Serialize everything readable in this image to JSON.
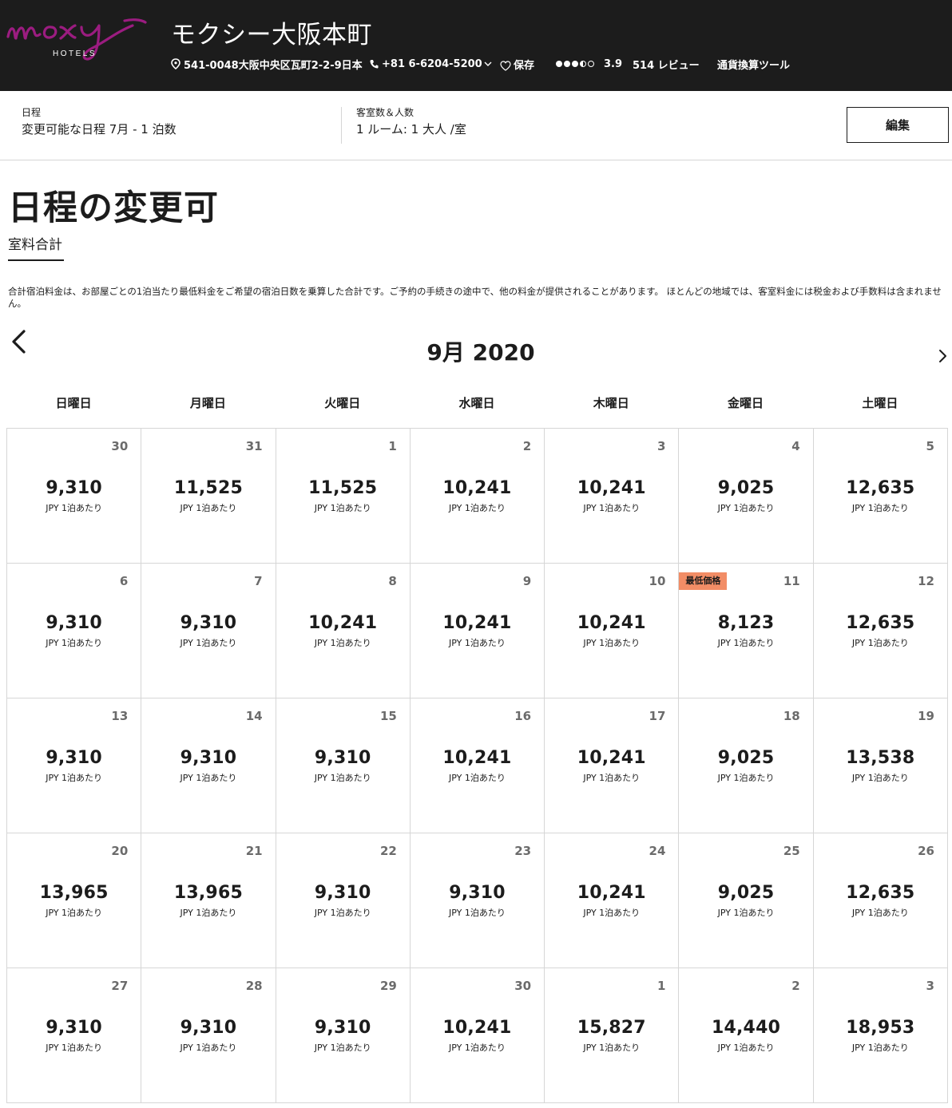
{
  "header": {
    "logo_text": "moxy",
    "logo_sub": "HOTELS",
    "hotel_name": "モクシー大阪本町",
    "address": "541-0048大阪中央区瓦町2-2-9日本",
    "phone": "+81 6-6204-5200",
    "save_label": "保存",
    "rating": "3.9",
    "reviews": "514 レビュー",
    "currency_tool": "通貨換算ツール",
    "brand_color": "#9b1c80"
  },
  "summary": {
    "dates_label": "日程",
    "dates_value": "変更可能な日程 7月 - 1 泊数",
    "guests_label": "客室数＆人数",
    "guests_value": "1 ルーム: 1 大人 /室",
    "edit_label": "編集"
  },
  "page": {
    "title": "日程の変更可",
    "tab_label": "室料合計",
    "note": "合計宿泊料金は、お部屋ごとの1泊当たり最低料金をご希望の宿泊日数を乗算した合計です。ご予約の手続きの途中で、他の料金が提供されることがあります。 ほとんどの地域では、客室料金には税金および手数料は含まれません。"
  },
  "calendar": {
    "month_title": "9月 2020",
    "unit_label": "JPY 1泊あたり",
    "lowest_badge": "最低価格",
    "badge_color": "#f28d66",
    "weekdays": [
      "日曜日",
      "月曜日",
      "火曜日",
      "水曜日",
      "木曜日",
      "金曜日",
      "土曜日"
    ],
    "weeks": [
      [
        {
          "day": "30",
          "price": "9,310"
        },
        {
          "day": "31",
          "price": "11,525"
        },
        {
          "day": "1",
          "price": "11,525"
        },
        {
          "day": "2",
          "price": "10,241"
        },
        {
          "day": "3",
          "price": "10,241"
        },
        {
          "day": "4",
          "price": "9,025"
        },
        {
          "day": "5",
          "price": "12,635"
        }
      ],
      [
        {
          "day": "6",
          "price": "9,310"
        },
        {
          "day": "7",
          "price": "9,310"
        },
        {
          "day": "8",
          "price": "10,241"
        },
        {
          "day": "9",
          "price": "10,241"
        },
        {
          "day": "10",
          "price": "10,241"
        },
        {
          "day": "11",
          "price": "8,123",
          "lowest": true
        },
        {
          "day": "12",
          "price": "12,635"
        }
      ],
      [
        {
          "day": "13",
          "price": "9,310"
        },
        {
          "day": "14",
          "price": "9,310"
        },
        {
          "day": "15",
          "price": "9,310"
        },
        {
          "day": "16",
          "price": "10,241"
        },
        {
          "day": "17",
          "price": "10,241"
        },
        {
          "day": "18",
          "price": "9,025"
        },
        {
          "day": "19",
          "price": "13,538"
        }
      ],
      [
        {
          "day": "20",
          "price": "13,965"
        },
        {
          "day": "21",
          "price": "13,965"
        },
        {
          "day": "22",
          "price": "9,310"
        },
        {
          "day": "23",
          "price": "9,310"
        },
        {
          "day": "24",
          "price": "10,241"
        },
        {
          "day": "25",
          "price": "9,025"
        },
        {
          "day": "26",
          "price": "12,635"
        }
      ],
      [
        {
          "day": "27",
          "price": "9,310"
        },
        {
          "day": "28",
          "price": "9,310"
        },
        {
          "day": "29",
          "price": "9,310"
        },
        {
          "day": "30",
          "price": "10,241"
        },
        {
          "day": "1",
          "price": "15,827"
        },
        {
          "day": "2",
          "price": "14,440"
        },
        {
          "day": "3",
          "price": "18,953"
        }
      ]
    ]
  }
}
